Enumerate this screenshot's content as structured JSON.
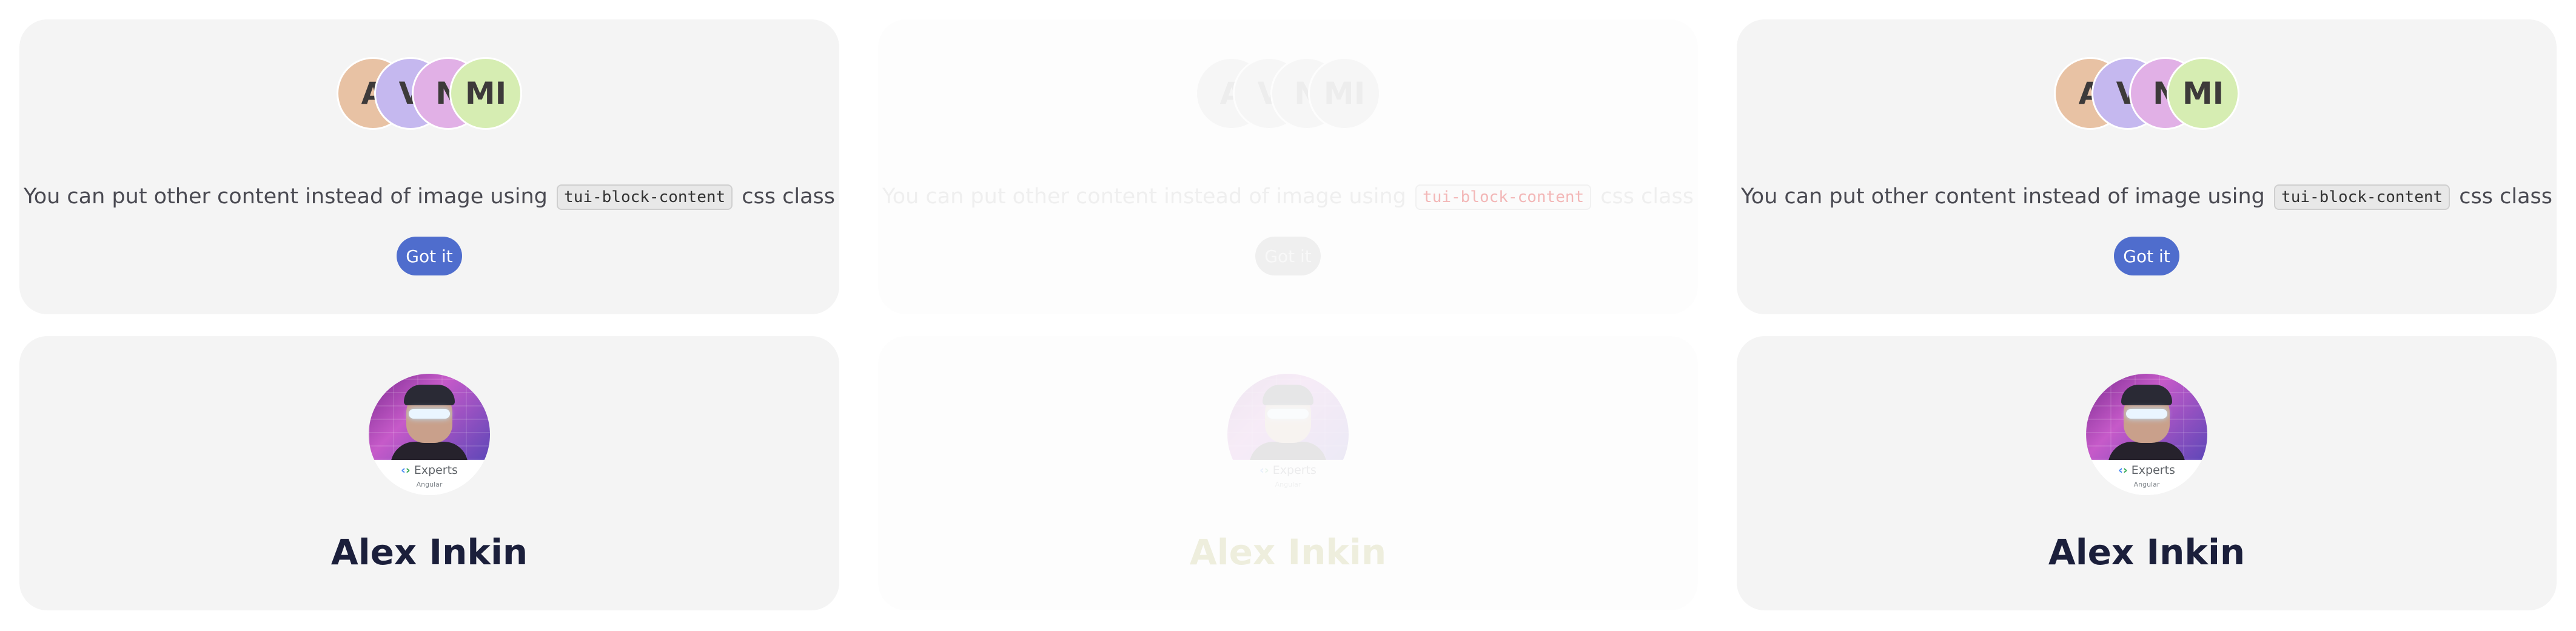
{
  "cards": {
    "avatar_card": {
      "avatars": [
        "A",
        "V",
        "N",
        "MI"
      ],
      "text_before": "You can put other content instead of image using",
      "code": "tui-block-content",
      "text_after": "css class",
      "button_label": "Got it"
    },
    "profile_card": {
      "badge_title": "Experts",
      "badge_subtitle": "Angular",
      "name": "Alex Inkin"
    }
  },
  "colors": {
    "card_bg": "#f4f4f4",
    "button_bg": "#4f6dcd",
    "name_color": "#1b1f3b",
    "avatar_colors": [
      "#e8c2a4",
      "#c5b8ef",
      "#e1b0e6",
      "#d6edb2"
    ]
  },
  "icons": [
    "google-developer-experts-icon"
  ]
}
